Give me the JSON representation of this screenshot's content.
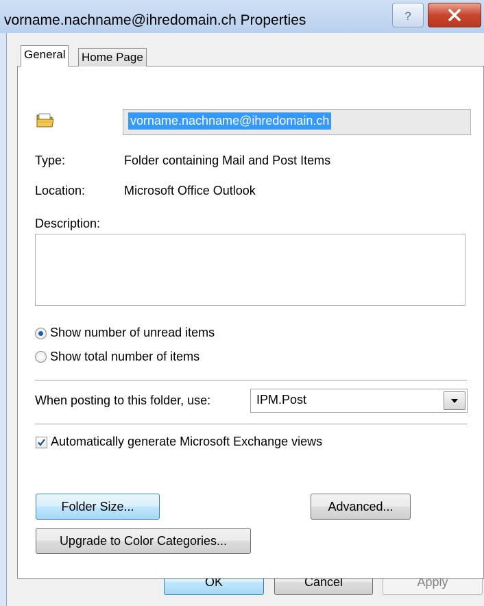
{
  "window": {
    "title": "vorname.nachname@ihredomain.ch Properties"
  },
  "tabs": [
    {
      "label": "General",
      "active": true
    },
    {
      "label": "Home Page",
      "active": false
    }
  ],
  "general": {
    "folder_name": "vorname.nachname@ihredomain.ch",
    "type_label": "Type:",
    "type_value": "Folder containing Mail and Post Items",
    "location_label": "Location:",
    "location_value": "Microsoft Office Outlook",
    "description_label": "Description:",
    "description_value": "",
    "radio_unread_label": "Show number of unread items",
    "radio_total_label": "Show total number of items",
    "radio_selected": "unread",
    "posting_label": "When posting to this folder, use:",
    "posting_value": "IPM.Post",
    "auto_views_label": "Automatically generate Microsoft Exchange views",
    "auto_views_checked": true,
    "folder_size_label": "Folder Size...",
    "advanced_label": "Advanced...",
    "upgrade_label": "Upgrade to Color Categories..."
  },
  "footer": {
    "ok_label": "OK",
    "cancel_label": "Cancel",
    "apply_label": "Apply"
  },
  "icons": {
    "help": "help-icon",
    "close": "close-icon",
    "folder": "folder-icon",
    "dropdown": "chevron-down-icon",
    "check": "checkmark-icon"
  },
  "colors": {
    "selection": "#3399ff",
    "close_button": "#c9462f",
    "radio_dot": "#1c5fb0",
    "focused_button": "#bee6fd"
  }
}
